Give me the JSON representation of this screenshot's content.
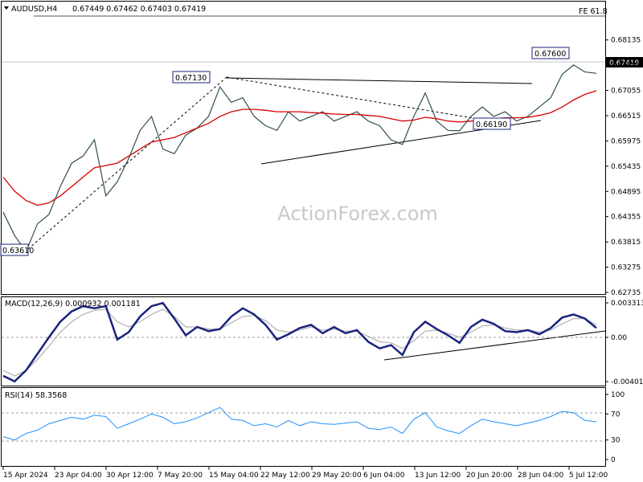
{
  "header": {
    "symbol": "AUDUSD,H4",
    "ohlc": "0.67449 0.67462 0.67403 0.67419",
    "fib_label": "FE 61.8",
    "current_price": "0.67419",
    "watermark": "ActionForex.com"
  },
  "chart_data": [
    {
      "type": "line",
      "panel": "price",
      "title": "AUDUSD,H4",
      "yticks": [
        "0.68135",
        "0.67595",
        "0.67055",
        "0.66515",
        "0.65975",
        "0.65435",
        "0.64895",
        "0.64355",
        "0.63815",
        "0.63275",
        "0.62735"
      ],
      "ylim": [
        0.62735,
        0.68405
      ],
      "xticks": [
        "15 Apr 2024",
        "23 Apr 04:00",
        "30 Apr 12:00",
        "7 May 20:00",
        "15 May 04:00",
        "22 May 12:00",
        "29 May 20:00",
        "6 Jun 04:00",
        "13 Jun 12:00",
        "20 Jun 20:00",
        "28 Jun 04:00",
        "5 Jul 12:00"
      ],
      "annotations": [
        "0.67600",
        "0.67130",
        "0.66190",
        "0.63610"
      ],
      "annotation_values": [
        0.676,
        0.6713,
        0.6619,
        0.6361
      ],
      "series": [
        {
          "values": [
            0.6445,
            0.6395,
            0.6361,
            0.642,
            0.644,
            0.65,
            0.655,
            0.6565,
            0.66,
            0.648,
            0.651,
            0.656,
            0.662,
            0.665,
            0.658,
            0.657,
            0.661,
            0.6625,
            0.665,
            0.6713,
            0.668,
            0.669,
            0.665,
            0.663,
            0.662,
            0.666,
            0.664,
            0.665,
            0.666,
            0.664,
            0.665,
            0.666,
            0.664,
            0.663,
            0.66,
            0.659,
            0.665,
            0.67,
            0.664,
            0.662,
            0.6619,
            0.665,
            0.667,
            0.665,
            0.666,
            0.664,
            0.665,
            0.667,
            0.669,
            0.674,
            0.676,
            0.6745,
            0.6742
          ]
        },
        {
          "values": [
            0.652,
            0.649,
            0.647,
            0.646,
            0.6465,
            0.648,
            0.65,
            0.652,
            0.654,
            0.6545,
            0.655,
            0.6565,
            0.658,
            0.6595,
            0.66,
            0.6605,
            0.6615,
            0.6625,
            0.6635,
            0.665,
            0.666,
            0.6665,
            0.6665,
            0.6663,
            0.666,
            0.666,
            0.666,
            0.6658,
            0.6657,
            0.6655,
            0.6654,
            0.6654,
            0.6652,
            0.665,
            0.6645,
            0.664,
            0.6642,
            0.6648,
            0.6645,
            0.664,
            0.6638,
            0.664,
            0.6643,
            0.6645,
            0.6647,
            0.6647,
            0.6648,
            0.6652,
            0.6658,
            0.667,
            0.6685,
            0.6697,
            0.6705
          ]
        }
      ]
    },
    {
      "type": "line",
      "panel": "macd",
      "title": "MACD(12,26,9) 0.000932 0.001181",
      "yticks": [
        "0.003313",
        "0.00",
        "-0.004016"
      ],
      "series": [
        {
          "values": [
            -0.0035,
            -0.004,
            -0.003,
            -0.0015,
            0.0,
            0.0015,
            0.0025,
            0.003,
            0.0028,
            0.003,
            -0.0002,
            0.0005,
            0.002,
            0.003,
            0.0033,
            0.0018,
            0.0002,
            0.001,
            0.0006,
            0.0008,
            0.002,
            0.0028,
            0.0022,
            0.0012,
            -0.0002,
            0.0003,
            0.0009,
            0.0012,
            0.0004,
            0.001,
            0.0004,
            0.0007,
            -0.0004,
            -0.001,
            -0.0007,
            -0.0016,
            0.0005,
            0.0015,
            0.0008,
            0.0002,
            -0.0005,
            0.001,
            0.0017,
            0.0013,
            0.0006,
            0.0005,
            0.0007,
            0.0003,
            0.0009,
            0.0019,
            0.0022,
            0.0018,
            0.0009
          ]
        },
        {
          "values": [
            -0.003,
            -0.0035,
            -0.003,
            -0.002,
            -0.0008,
            0.0005,
            0.0015,
            0.0022,
            0.0026,
            0.0027,
            0.0015,
            0.001,
            0.0015,
            0.0022,
            0.0027,
            0.002,
            0.001,
            0.001,
            0.0008,
            0.0008,
            0.0014,
            0.002,
            0.0021,
            0.0016,
            0.0007,
            0.0005,
            0.0007,
            0.001,
            0.0007,
            0.0008,
            0.0006,
            0.0006,
            0.0001,
            -0.0004,
            -0.0005,
            -0.001,
            -0.0003,
            0.0006,
            0.0007,
            0.0004,
            0.0,
            0.0005,
            0.0011,
            0.0012,
            0.0009,
            0.0007,
            0.0007,
            0.0005,
            0.0007,
            0.0013,
            0.0018,
            0.0018,
            0.0012
          ]
        }
      ]
    },
    {
      "type": "line",
      "panel": "rsi",
      "title": "RSI(14) 58.3568",
      "yticks": [
        "100",
        "70",
        "30",
        "0"
      ],
      "ylim": [
        0,
        100
      ],
      "series": [
        {
          "values": [
            35,
            30,
            40,
            45,
            55,
            60,
            65,
            62,
            68,
            66,
            48,
            55,
            62,
            70,
            65,
            55,
            58,
            64,
            72,
            80,
            62,
            60,
            52,
            55,
            50,
            60,
            52,
            58,
            55,
            54,
            56,
            58,
            48,
            46,
            50,
            40,
            62,
            72,
            50,
            44,
            40,
            52,
            62,
            58,
            55,
            52,
            56,
            60,
            66,
            74,
            72,
            60,
            58
          ]
        }
      ]
    }
  ]
}
